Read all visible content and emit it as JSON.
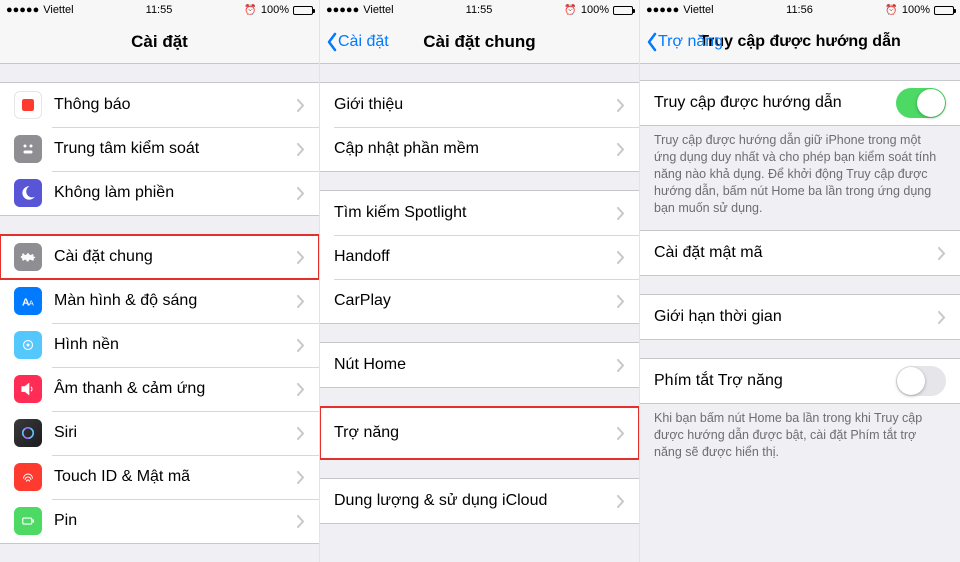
{
  "status": {
    "carrier": "Viettel",
    "signal_dots": "●●●●●",
    "battery_text": "100%",
    "alarm": "⏰"
  },
  "pane1": {
    "time": "11:55",
    "title": "Cài đặt",
    "group1": [
      {
        "icon": "notifications",
        "label": "Thông báo",
        "color": "#ff3b30"
      },
      {
        "icon": "control-center",
        "label": "Trung tâm kiểm soát",
        "color": "#8e8e93"
      },
      {
        "icon": "dnd",
        "label": "Không làm phiền",
        "color": "#5856d6"
      }
    ],
    "group2": [
      {
        "icon": "general",
        "label": "Cài đặt chung",
        "color": "#8e8e93",
        "highlight": true
      },
      {
        "icon": "display",
        "label": "Màn hình & độ sáng",
        "color": "#007aff"
      },
      {
        "icon": "wallpaper",
        "label": "Hình nền",
        "color": "#54c7fc"
      },
      {
        "icon": "sounds",
        "label": "Âm thanh & cảm ứng",
        "color": "#ff2d55"
      },
      {
        "icon": "siri",
        "label": "Siri",
        "color": "#000"
      },
      {
        "icon": "touchid",
        "label": "Touch ID & Mật mã",
        "color": "#ff3b30"
      },
      {
        "icon": "pin",
        "label": "Pin",
        "color": "#4cd964"
      }
    ]
  },
  "pane2": {
    "time": "11:55",
    "back": "Cài đặt",
    "title": "Cài đặt chung",
    "group1": [
      {
        "label": "Giới thiệu"
      },
      {
        "label": "Cập nhật phần mềm"
      }
    ],
    "group2": [
      {
        "label": "Tìm kiếm Spotlight"
      },
      {
        "label": "Handoff"
      },
      {
        "label": "CarPlay"
      }
    ],
    "group3": [
      {
        "label": "Nút Home"
      }
    ],
    "group4": [
      {
        "label": "Trợ năng",
        "highlight": true
      }
    ],
    "group5": [
      {
        "label": "Dung lượng & sử dụng iCloud"
      }
    ]
  },
  "pane3": {
    "time": "11:56",
    "back": "Trợ năng",
    "title": "Truy cập được hướng dẫn",
    "toggle1_label": "Truy cập được hướng dẫn",
    "toggle1_on": true,
    "footer1": "Truy cập được hướng dẫn giữ iPhone trong một ứng dụng duy nhất và cho phép bạn kiểm soát tính năng nào khả dụng. Để khởi động Truy cập được hướng dẫn, bấm nút Home ba lần trong ứng dụng bạn muốn sử dụng.",
    "row_passcode": "Cài đặt mật mã",
    "row_timelimit": "Giới hạn thời gian",
    "toggle2_label": "Phím tắt Trợ năng",
    "toggle2_on": false,
    "footer2": "Khi bạn bấm nút Home ba lần trong khi Truy cập được hướng dẫn được bật, cài đặt Phím tắt trợ năng sẽ được hiển thị."
  }
}
